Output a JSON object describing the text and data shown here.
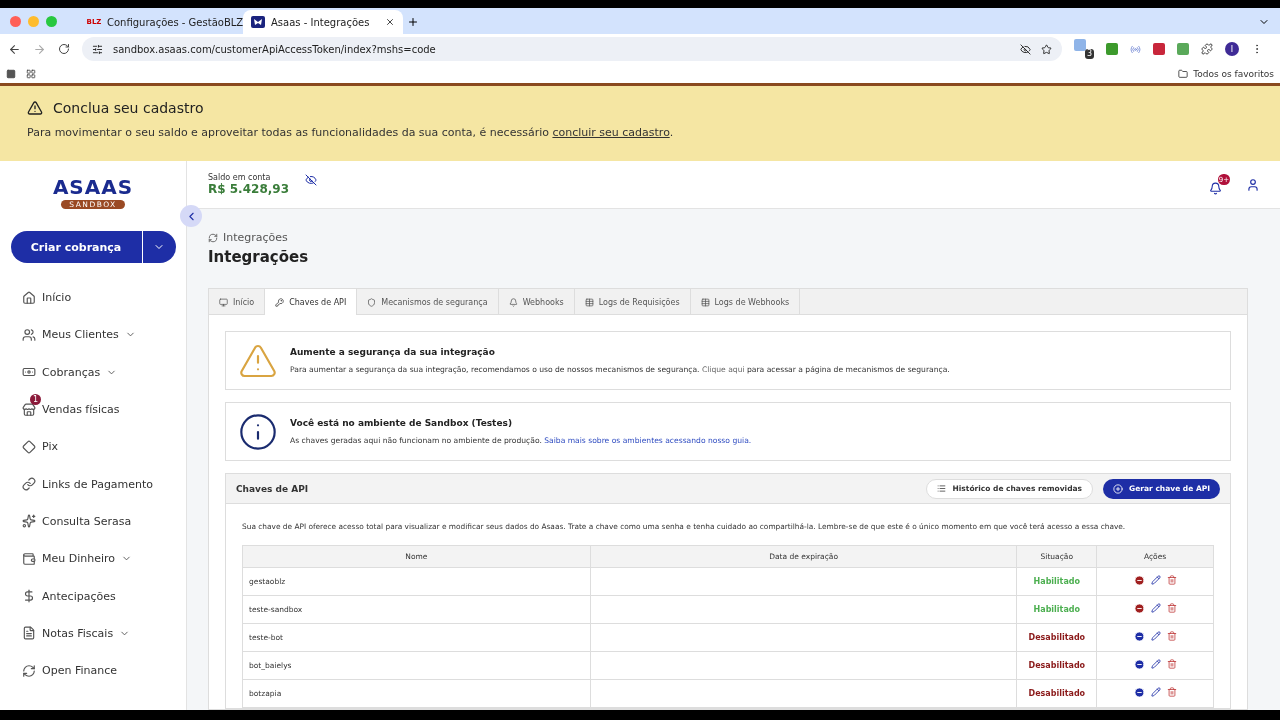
{
  "browser": {
    "tabs": [
      {
        "title": "Configurações - GestãoBLZ",
        "favicon": "BLZ",
        "selected": false
      },
      {
        "title": "Asaas - Integrações",
        "selected": true
      }
    ],
    "url": "sandbox.asaas.com/customerApiAccessToken/index?mshs=code",
    "extension_badge": "3",
    "profile_initial": "I",
    "bookmarks_label": "Todos os favoritos"
  },
  "banner": {
    "title": "Conclua seu cadastro",
    "text": "Para movimentar o seu saldo e aproveitar todas as funcionalidades da sua conta, é necessário ",
    "link": "concluir seu cadastro",
    "text_after": "."
  },
  "sidebar": {
    "logo": "ASAAS",
    "logo_badge": "SANDBOX",
    "create_button": "Criar cobrança",
    "items": [
      {
        "label": "Início",
        "expandable": false
      },
      {
        "label": "Meus Clientes",
        "expandable": true
      },
      {
        "label": "Cobranças",
        "expandable": true
      },
      {
        "label": "Vendas físicas",
        "expandable": false,
        "badge": "1"
      },
      {
        "label": "Pix",
        "expandable": false
      },
      {
        "label": "Links de Pagamento",
        "expandable": false
      },
      {
        "label": "Consulta Serasa",
        "expandable": false
      },
      {
        "label": "Meu Dinheiro",
        "expandable": true
      },
      {
        "label": "Antecipações",
        "expandable": false
      },
      {
        "label": "Notas Fiscais",
        "expandable": true
      },
      {
        "label": "Open Finance",
        "expandable": false
      }
    ]
  },
  "header": {
    "balance_label": "Saldo em conta",
    "balance": "R$ 5.428,93",
    "notifications_badge": "9+"
  },
  "page": {
    "breadcrumb": "Integrações",
    "title": "Integrações",
    "tabs": [
      {
        "label": "Início",
        "selected": false
      },
      {
        "label": "Chaves de API",
        "selected": true
      },
      {
        "label": "Mecanismos de segurança",
        "selected": false
      },
      {
        "label": "Webhooks",
        "selected": false
      },
      {
        "label": "Logs de Requisições",
        "selected": false
      },
      {
        "label": "Logs de Webhooks",
        "selected": false
      }
    ]
  },
  "alerts": [
    {
      "kind": "warning",
      "title": "Aumente a segurança da sua integração",
      "text": "Para aumentar a segurança da sua integração, recomendamos o uso de nossos mecanismos de segurança. ",
      "link": "Clique aqui",
      "text_after": " para acessar a página de mecanismos de segurança."
    },
    {
      "kind": "info",
      "title": "Você está no ambiente de Sandbox (Testes)",
      "text": "As chaves geradas aqui não funcionam no ambiente de produção. ",
      "link": "Saiba mais sobre os ambientes acessando nosso guia."
    }
  ],
  "keys": {
    "title": "Chaves de API",
    "history_button": "Histórico de chaves removidas",
    "generate_button": "Gerar chave de API",
    "description": "Sua chave de API oferece acesso total para visualizar e modificar seus dados do Asaas. Trate a chave como uma senha e tenha cuidado ao compartilhá-la. Lembre-se de que este é o único momento em que você terá acesso a essa chave.",
    "columns": [
      "Nome",
      "Data de expiração",
      "Situação",
      "Ações"
    ],
    "rows": [
      {
        "name": "gestaoblz",
        "status": "Habilitado",
        "enabled": true
      },
      {
        "name": "teste-sandbox",
        "status": "Habilitado",
        "enabled": true
      },
      {
        "name": "teste-bot",
        "status": "Desabilitado",
        "enabled": false
      },
      {
        "name": "bot_baielys",
        "status": "Desabilitado",
        "enabled": false
      },
      {
        "name": "botzapia",
        "status": "Desabilitado",
        "enabled": false
      }
    ]
  }
}
